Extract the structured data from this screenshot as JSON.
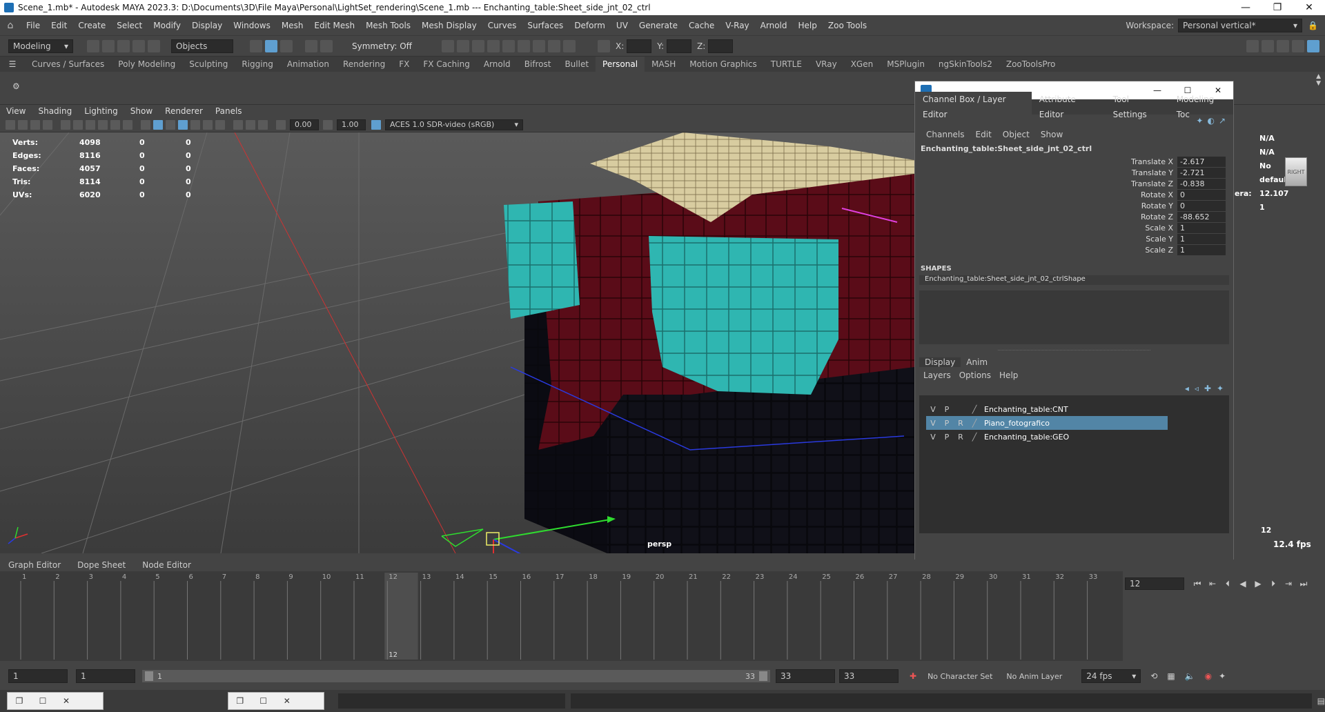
{
  "titlebar": {
    "title": "Scene_1.mb* - Autodesk MAYA 2023.3: D:\\Documents\\3D\\File Maya\\Personal\\LightSet_rendering\\Scene_1.mb  ---  Enchanting_table:Sheet_side_jnt_02_ctrl",
    "minimize": "—",
    "maximize": "❐",
    "close": "✕"
  },
  "menubar": {
    "items": [
      "File",
      "Edit",
      "Create",
      "Select",
      "Modify",
      "Display",
      "Windows",
      "Mesh",
      "Edit Mesh",
      "Mesh Tools",
      "Mesh Display",
      "Curves",
      "Surfaces",
      "Deform",
      "UV",
      "Generate",
      "Cache",
      "V-Ray",
      "Arnold",
      "Help",
      "Zoo Tools"
    ],
    "workspace_label": "Workspace:",
    "workspace_value": "Personal vertical*"
  },
  "statusline": {
    "mode": "Modeling",
    "objects": "Objects",
    "symmetry": "Symmetry: Off",
    "x_label": "X:",
    "y_label": "Y:",
    "z_label": "Z:"
  },
  "shelf_tabs": [
    "Curves / Surfaces",
    "Poly Modeling",
    "Sculpting",
    "Rigging",
    "Animation",
    "Rendering",
    "FX",
    "FX Caching",
    "Arnold",
    "Bifrost",
    "Bullet",
    "Personal",
    "MASH",
    "Motion Graphics",
    "TURTLE",
    "VRay",
    "XGen",
    "MSPlugin",
    "ngSkinTools2",
    "ZooToolsPro"
  ],
  "shelf_active": "Personal",
  "panel_menu": [
    "View",
    "Shading",
    "Lighting",
    "Show",
    "Renderer",
    "Panels"
  ],
  "panel_bar": {
    "exposure": "0.00",
    "gamma": "1.00",
    "colorspace": "ACES 1.0 SDR-video (sRGB)"
  },
  "hud": {
    "rows": [
      {
        "label": "Verts:",
        "a": "4098",
        "b": "0",
        "c": "0"
      },
      {
        "label": "Edges:",
        "a": "8116",
        "b": "0",
        "c": "0"
      },
      {
        "label": "Faces:",
        "a": "4057",
        "b": "0",
        "c": "0"
      },
      {
        "label": "Tris:",
        "a": "8114",
        "b": "0",
        "c": "0"
      },
      {
        "label": "UVs:",
        "a": "6020",
        "b": "0",
        "c": "0"
      }
    ],
    "right": {
      "na1": "N/A",
      "na2": "N/A",
      "no": "No",
      "default": "default",
      "camera_label": "era:",
      "camera_value": "12.107",
      "one": "1",
      "frame": "12",
      "fps": "12.4 fps",
      "cube_label": "RIGHT"
    },
    "camera_name": "persp"
  },
  "channel_box": {
    "tabs": [
      "Channel Box / Layer Editor",
      "Attribute Editor",
      "Tool Settings",
      "Modeling Toc"
    ],
    "menu": [
      "Channels",
      "Edit",
      "Object",
      "Show"
    ],
    "node_name": "Enchanting_table:Sheet_side_jnt_02_ctrl",
    "attributes": [
      {
        "label": "Translate X",
        "value": "-2.617"
      },
      {
        "label": "Translate Y",
        "value": "-2.721"
      },
      {
        "label": "Translate Z",
        "value": "-0.838"
      },
      {
        "label": "Rotate X",
        "value": "0"
      },
      {
        "label": "Rotate Y",
        "value": "0"
      },
      {
        "label": "Rotate Z",
        "value": "-88.652"
      },
      {
        "label": "Scale X",
        "value": "1"
      },
      {
        "label": "Scale Y",
        "value": "1"
      },
      {
        "label": "Scale Z",
        "value": "1"
      }
    ],
    "shapes_header": "SHAPES",
    "shape_name": "Enchanting_table:Sheet_side_jnt_02_ctrlShape"
  },
  "layer_editor": {
    "tabs": [
      "Display",
      "Anim"
    ],
    "menu": [
      "Layers",
      "Options",
      "Help"
    ],
    "layers": [
      {
        "v": "V",
        "p": "P",
        "r": "",
        "name": "Enchanting_table:CNT",
        "selected": false
      },
      {
        "v": "V",
        "p": "P",
        "r": "R",
        "name": "Piano_fotografico",
        "selected": true
      },
      {
        "v": "V",
        "p": "P",
        "r": "R",
        "name": "Enchanting_table:GEO",
        "selected": false
      }
    ]
  },
  "time_editors": [
    "Graph Editor",
    "Dope Sheet",
    "Node Editor"
  ],
  "timeline": {
    "frames": [
      "1",
      "2",
      "3",
      "4",
      "5",
      "6",
      "7",
      "8",
      "9",
      "10",
      "11",
      "12",
      "13",
      "14",
      "15",
      "16",
      "17",
      "18",
      "19",
      "20",
      "21",
      "22",
      "23",
      "24",
      "25",
      "26",
      "27",
      "28",
      "29",
      "30",
      "31",
      "32",
      "33"
    ],
    "current_frame": "12",
    "current_frame_field": "12"
  },
  "range": {
    "start": "1",
    "anim_start": "1",
    "slider_start": "1",
    "slider_end": "33",
    "anim_end": "33",
    "end": "33",
    "character_set": "No Character Set",
    "anim_layer": "No Anim Layer",
    "fps": "24 fps"
  },
  "colors": {
    "accent": "#5285a6",
    "cyan": "#2fb6b1",
    "red": "#6d0e1a"
  }
}
